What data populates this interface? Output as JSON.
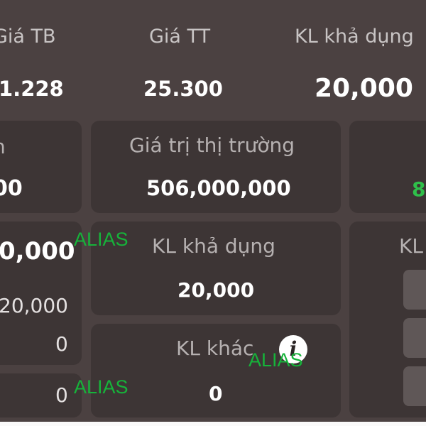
{
  "header": {
    "avg_price_label": "Giá TB",
    "avg_price_value": "1.228",
    "market_price_label": "Giá TT",
    "market_price_value": "25.300",
    "available_qty_label": "KL khả dụng",
    "available_qty_value": "20,000"
  },
  "row1": {
    "left_label": "n",
    "left_value": "00",
    "market_value_label": "Giá trị thị trường",
    "market_value_value": "506,000,000",
    "right_value": "8"
  },
  "row2": {
    "left_value_main": "0,000",
    "left_value_sub": "20,000",
    "left_value_zero": "0",
    "available_label": "KL khả dụng",
    "available_value": "20,000",
    "right_label": "KL"
  },
  "row3": {
    "left_value": "0",
    "other_label": "KL khác",
    "other_value": "0"
  },
  "overlays": {
    "alias_1": "ALIAS",
    "alias_2": "ALIAS",
    "alias_3": "ALIAS"
  },
  "colors": {
    "background": "#4b4141",
    "card": "#3d3535",
    "alias": "#16b33a",
    "positive": "#2fbf4a"
  }
}
